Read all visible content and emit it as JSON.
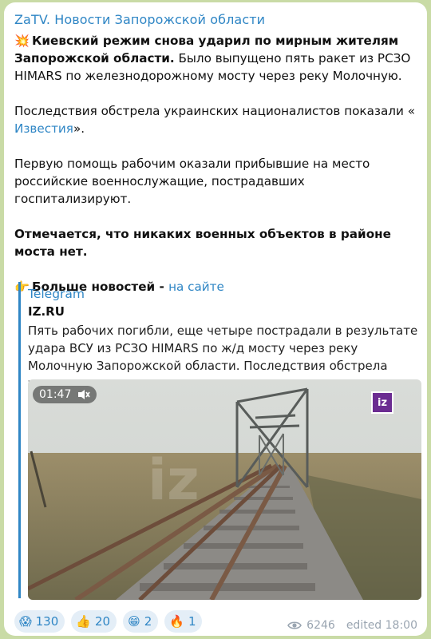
{
  "channel": {
    "name": "ZaTV. Новости Запорожской области"
  },
  "post": {
    "p1_emoji": "💥",
    "p1_bold": "Киевский режим снова ударил по мирным жителям Запорожской области.",
    "p1_rest": " Было выпущено пять ракет из РСЗО HIMARS по железнодорожному мосту через реку Молочную.",
    "p2_text": "Последствия обстрела украинских националистов показали «",
    "p2_link": "Известия",
    "p2_end": "».",
    "p3": "Первую помощь рабочим оказали прибывшие на место российские военнослужащие, пострадавших госпитализируют.",
    "p4": "Отмечается, что никаких военных объектов в районе моста нет.",
    "p5_emoji": "👉",
    "p5_text": "Больше новостей - ",
    "p5_link": "на сайте"
  },
  "preview": {
    "source": "Telegram",
    "title": "IZ.RU",
    "description": "Пять рабочих погибли, еще четыре пострадали в результате удара ВСУ из РСЗО HIMARS по ж/д мосту через реку Молочную Запорожской области. Последствия обстрела украинских на…",
    "video_time": "01:47",
    "watermark": "iz"
  },
  "reactions": [
    {
      "emoji": "😱",
      "count": "130"
    },
    {
      "emoji": "👍",
      "count": "20"
    },
    {
      "emoji": "😁",
      "count": "2"
    },
    {
      "emoji": "🔥",
      "count": "1"
    }
  ],
  "meta": {
    "views": "6246",
    "edited": "edited 18:00"
  },
  "icons": {
    "views": "eye-icon",
    "mute": "speaker-muted-icon"
  },
  "colors": {
    "accent": "#2f86c5",
    "background": "#c9dba6"
  }
}
